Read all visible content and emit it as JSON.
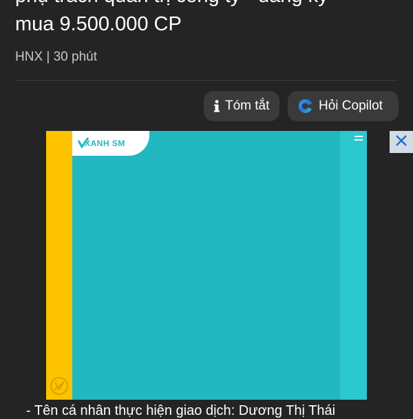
{
  "article": {
    "title_line1": "phụ trách quản trị công ty - đăng ký",
    "title_line2": "mua 9.500.000 CP",
    "meta": "HNX | 30 phút",
    "body_preview": "- Tên cá nhân thực hiện giao dịch: Dương Thị Thái"
  },
  "actions": {
    "summary_label": "Tóm tắt",
    "copilot_label": "Hỏi Copilot"
  },
  "ad": {
    "brand_text": "XANH SM",
    "menu_icon": "menu-icon",
    "close_icon": "close-icon",
    "colors": {
      "main": "#22b7c1",
      "left_strip": "#fdc300",
      "right_strip": "#2cc8cf"
    }
  },
  "colors": {
    "background": "#242424",
    "pill": "#3a3a3a"
  }
}
